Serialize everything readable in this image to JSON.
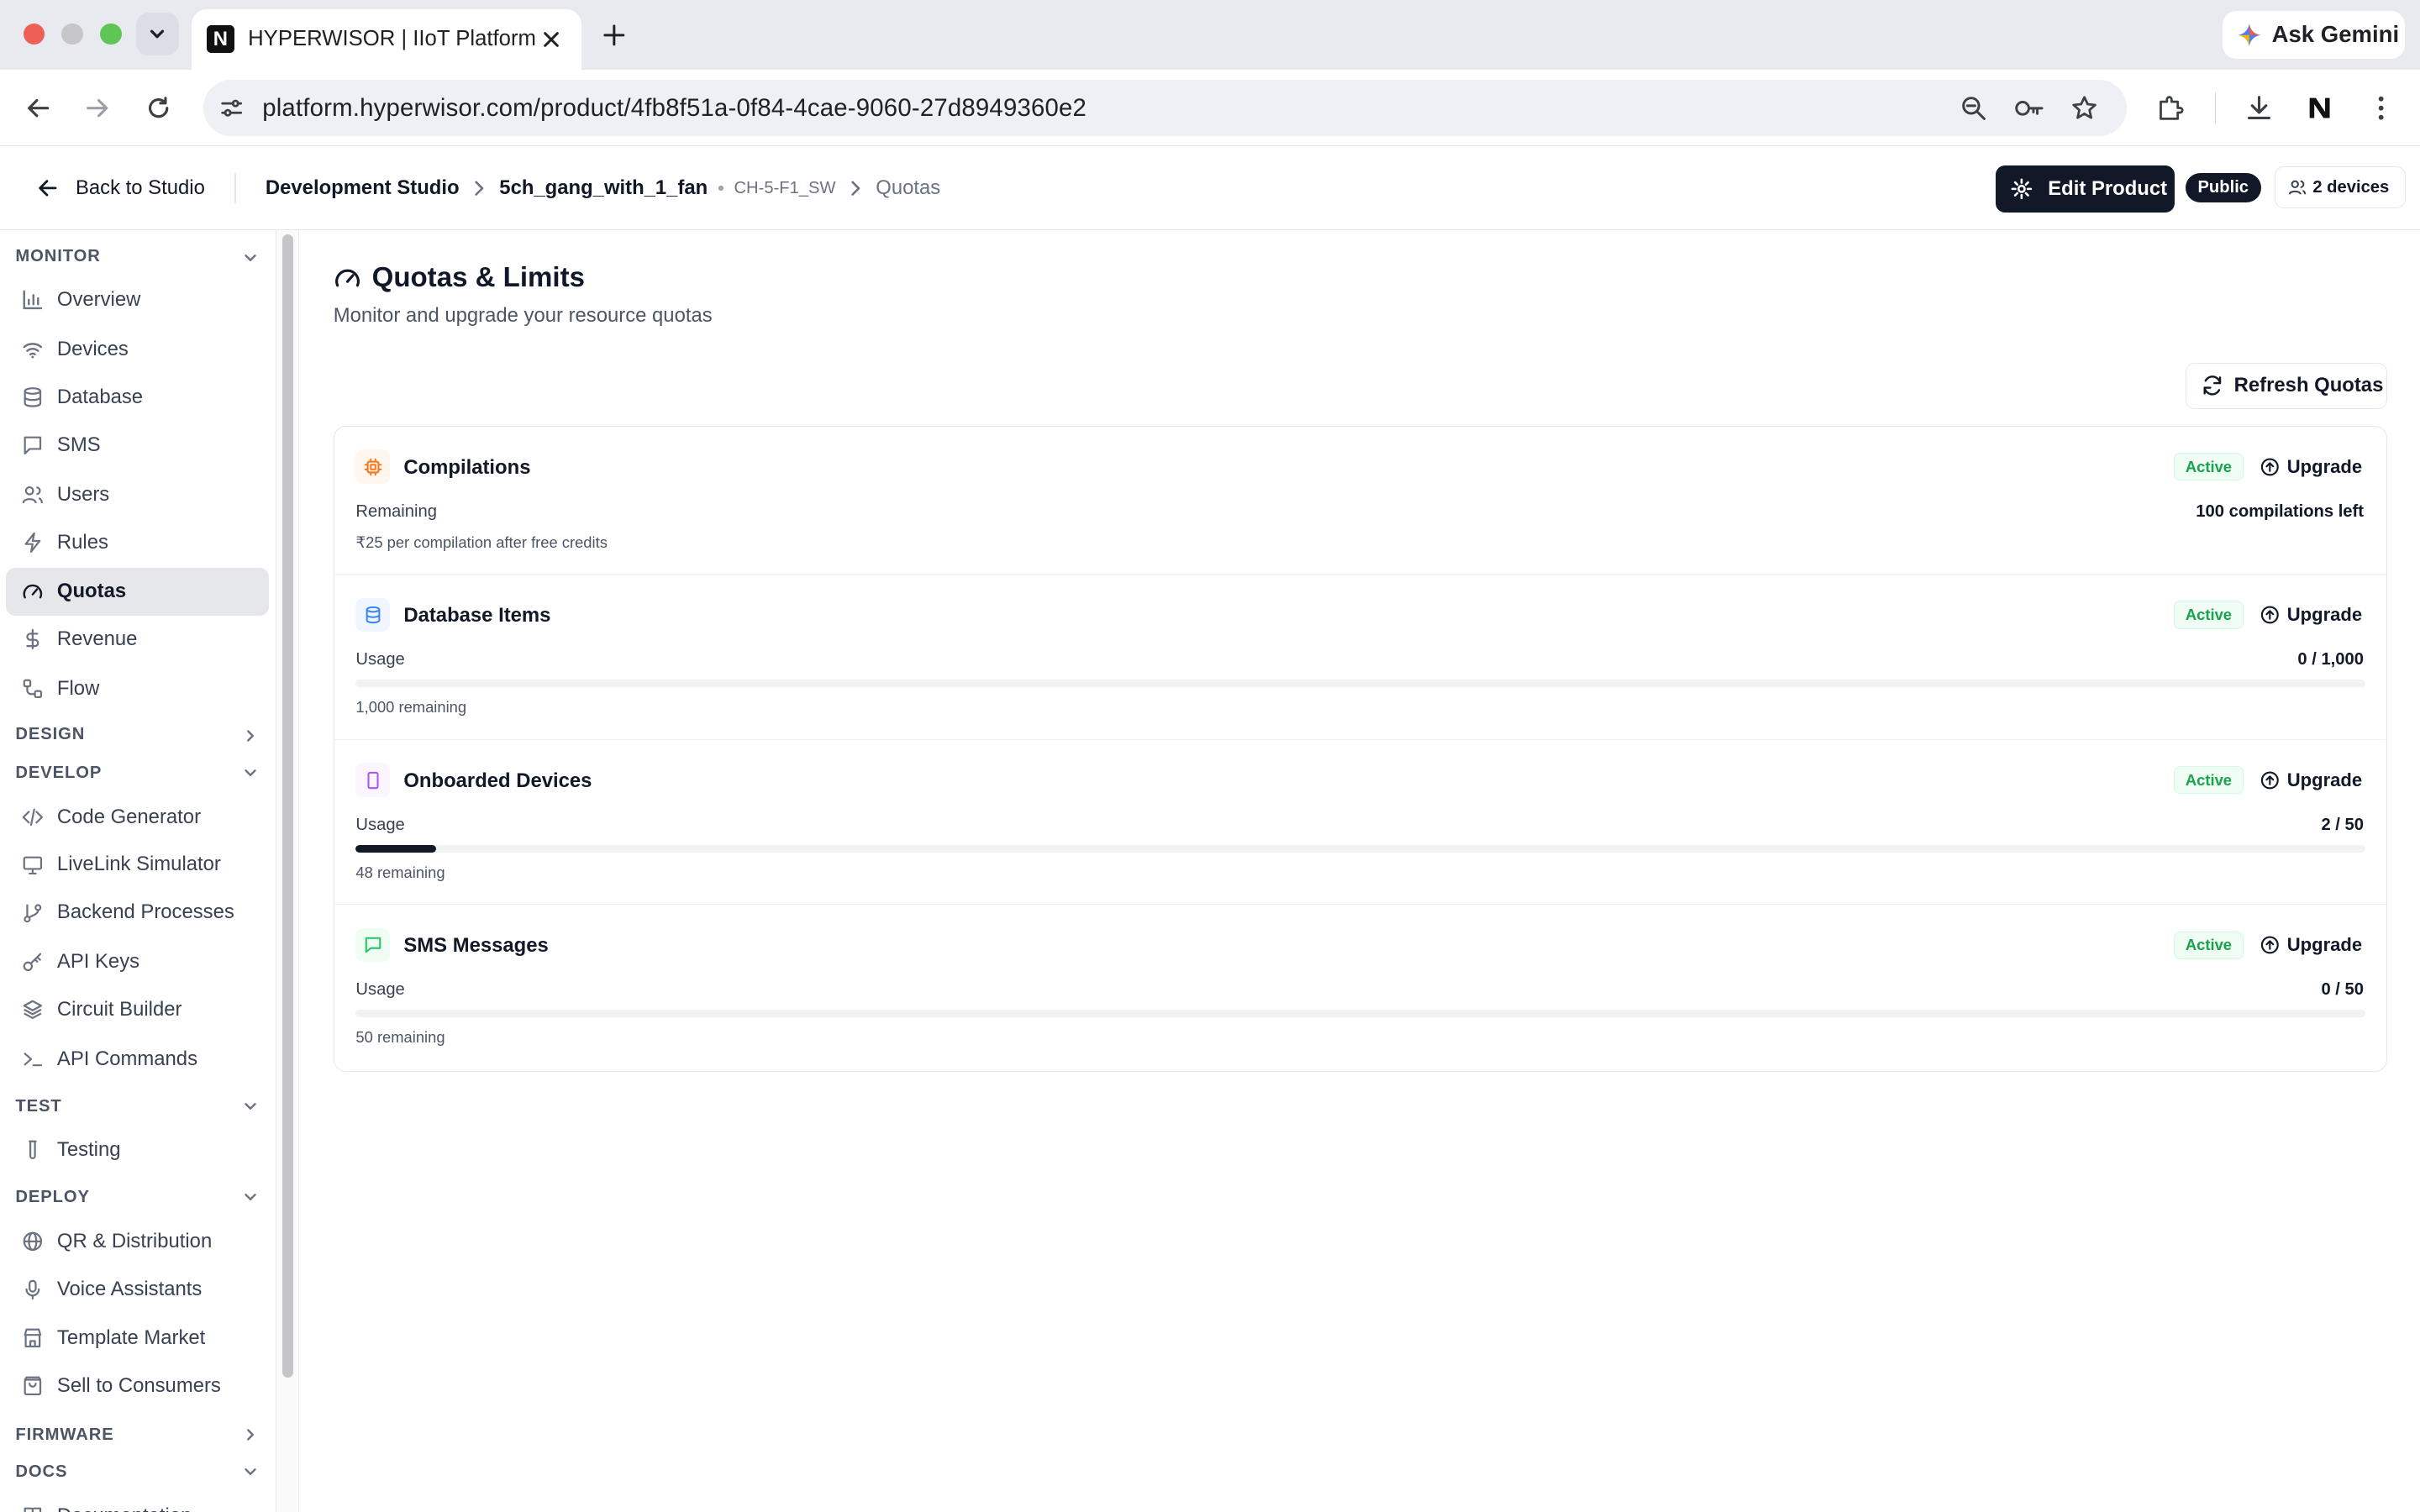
{
  "browser": {
    "tab_title": "HYPERWISOR | IIoT Platform",
    "url": "platform.hyperwisor.com/product/4fb8f51a-0f84-4cae-9060-27d8949360e2",
    "gemini_label": "Ask Gemini",
    "favicon_letter": "N"
  },
  "header": {
    "back_label": "Back to Studio",
    "crumb_studio": "Development Studio",
    "crumb_product": "5ch_gang_with_1_fan",
    "crumb_code": "CH-5-F1_SW",
    "crumb_current": "Quotas",
    "edit_label": "Edit Product",
    "public_label": "Public",
    "devices_label": "2 devices"
  },
  "sidebar": {
    "monitor": "MONITOR",
    "design": "DESIGN",
    "develop": "DEVELOP",
    "test": "TEST",
    "deploy": "DEPLOY",
    "firmware": "FIRMWARE",
    "docs": "DOCS",
    "items": {
      "overview": "Overview",
      "devices": "Devices",
      "database": "Database",
      "sms": "SMS",
      "users": "Users",
      "rules": "Rules",
      "quotas": "Quotas",
      "revenue": "Revenue",
      "flow": "Flow",
      "code_generator": "Code Generator",
      "livelink": "LiveLink Simulator",
      "backend": "Backend Processes",
      "api_keys": "API Keys",
      "circuit": "Circuit Builder",
      "api_commands": "API Commands",
      "testing": "Testing",
      "qr": "QR & Distribution",
      "voice": "Voice Assistants",
      "template": "Template Market",
      "sell": "Sell to Consumers",
      "documentation": "Documentation"
    }
  },
  "main": {
    "title": "Quotas & Limits",
    "subtitle": "Monitor and upgrade your resource quotas",
    "refresh_label": "Refresh Quotas",
    "quotas": [
      {
        "name": "Compilations",
        "status": "Active",
        "upgrade": "Upgrade",
        "label": "Remaining",
        "value": "100 compilations left",
        "note": "₹25 per compilation after free credits",
        "color": "#f97316"
      },
      {
        "name": "Database Items",
        "status": "Active",
        "upgrade": "Upgrade",
        "label": "Usage",
        "value": "0 / 1,000",
        "note": "1,000 remaining",
        "progress": 0,
        "color": "#3b82f6"
      },
      {
        "name": "Onboarded Devices",
        "status": "Active",
        "upgrade": "Upgrade",
        "label": "Usage",
        "value": "2 / 50",
        "note": "48 remaining",
        "progress": 0.04,
        "color": "#a855f7"
      },
      {
        "name": "SMS Messages",
        "status": "Active",
        "upgrade": "Upgrade",
        "label": "Usage",
        "value": "0 / 50",
        "note": "50 remaining",
        "progress": 0,
        "color": "#22c55e"
      }
    ]
  }
}
